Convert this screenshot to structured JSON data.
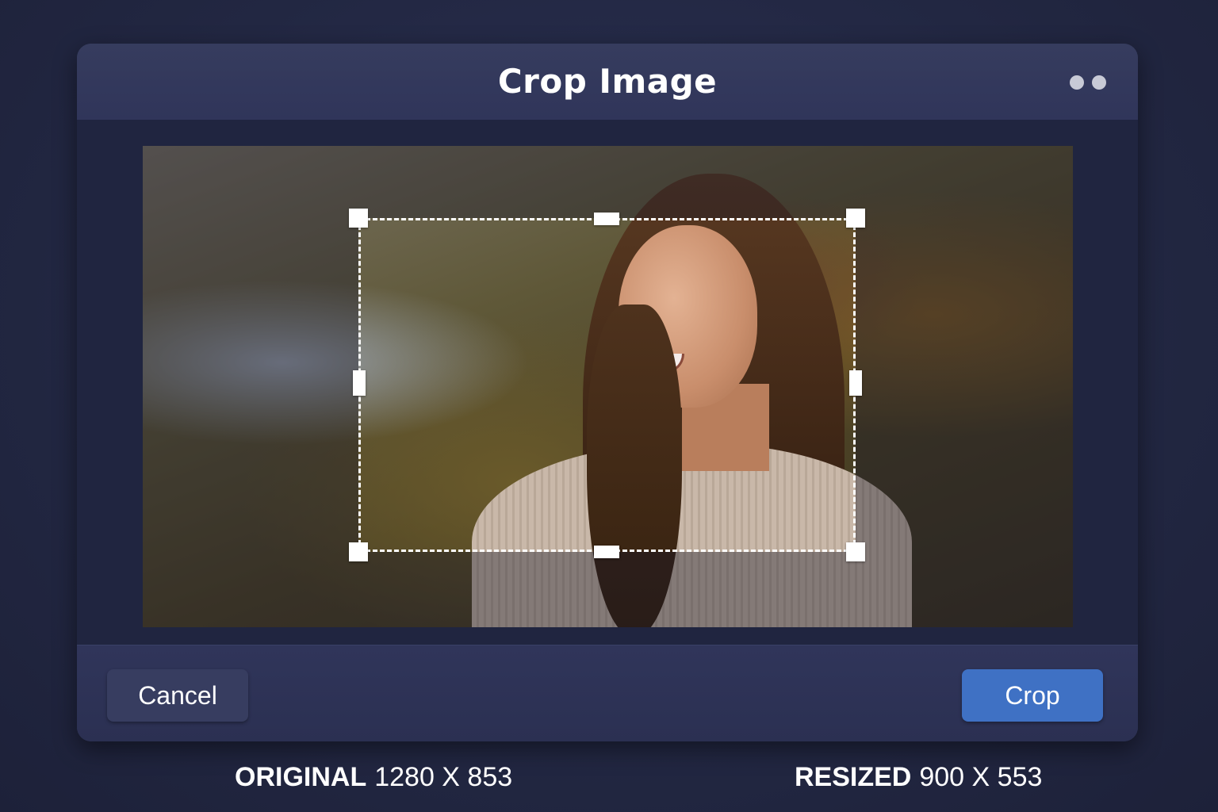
{
  "dialog": {
    "title": "Crop Image",
    "cancel_label": "Cancel",
    "crop_label": "Crop"
  },
  "dimensions": {
    "original_label": "ORIGINAL",
    "original_value": "1280 X 853",
    "resized_label": "RESIZED",
    "resized_value": "900 X 553"
  },
  "colors": {
    "accent": "#3f71c4",
    "background": "#232845",
    "dialog": "#2b3050"
  },
  "icons": {
    "window_controls": "window-dots-icon"
  }
}
